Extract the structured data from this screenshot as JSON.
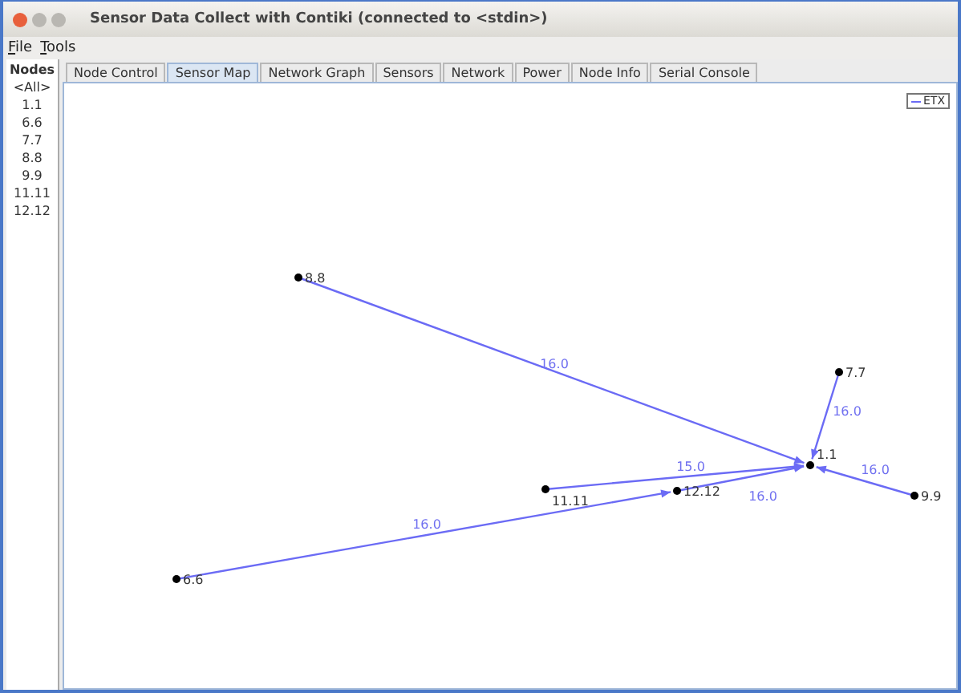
{
  "window": {
    "title": "Sensor Data Collect with Contiki (connected to <stdin>)"
  },
  "menu": [
    "File",
    "Tools"
  ],
  "nodes_list": {
    "header": "Nodes",
    "items": [
      {
        "label": "<All>",
        "selected": false
      },
      {
        "label": "1.1",
        "selected": false
      },
      {
        "label": "6.6",
        "selected": false
      },
      {
        "label": "7.7",
        "selected": false
      },
      {
        "label": "8.8",
        "selected": false
      },
      {
        "label": "9.9",
        "selected": false
      },
      {
        "label": "11.11",
        "selected": false
      },
      {
        "label": "12.12",
        "selected": false
      }
    ]
  },
  "tabs": [
    {
      "label": "Node Control",
      "selected": false
    },
    {
      "label": "Sensor Map",
      "selected": true
    },
    {
      "label": "Network Graph",
      "selected": false
    },
    {
      "label": "Sensors",
      "selected": false
    },
    {
      "label": "Network",
      "selected": false
    },
    {
      "label": "Power",
      "selected": false
    },
    {
      "label": "Node Info",
      "selected": false
    },
    {
      "label": "Serial Console",
      "selected": false
    }
  ],
  "map": {
    "legend": "ETX",
    "nodes": [
      {
        "label": "1.1"
      },
      {
        "label": "7.7"
      },
      {
        "label": "8.8"
      },
      {
        "label": "9.9"
      },
      {
        "label": "11.11"
      },
      {
        "label": "12.12"
      },
      {
        "label": "6.6"
      }
    ],
    "links": [
      {
        "label": "16.0"
      },
      {
        "label": "16.0"
      },
      {
        "label": "16.0"
      },
      {
        "label": "15.0"
      },
      {
        "label": "16.0"
      },
      {
        "label": "16.0"
      }
    ]
  }
}
